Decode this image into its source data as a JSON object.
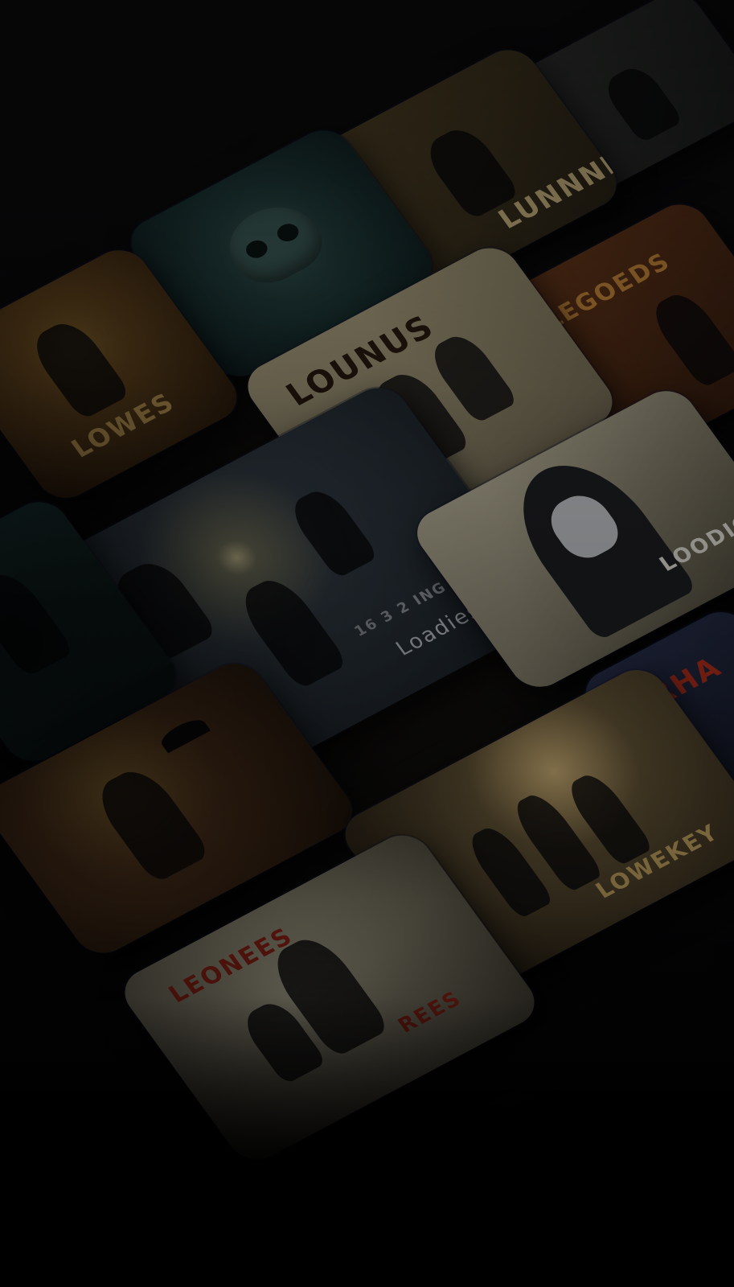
{
  "background": {
    "description_free": true,
    "colors": {
      "base": "#050506",
      "warm_glow": "#6b5530",
      "cool_edge": "#1c2552"
    }
  },
  "posters": [
    {
      "name": "poster-top-right",
      "title": "",
      "palette": [
        "#3a3d3a",
        "#1b1d1c"
      ],
      "title_color": "#c9b27a"
    },
    {
      "name": "poster-top-center",
      "title": "LUNNNN",
      "palette": [
        "#5a4a2a",
        "#2a2418"
      ],
      "title_color": "#d9c28a"
    },
    {
      "name": "poster-skull-teal",
      "title": "",
      "palette": [
        "#23403f",
        "#0f1f21"
      ],
      "title_color": "#b7c7b8"
    },
    {
      "name": "poster-orange-right",
      "title": "LEGOEDS",
      "palette": [
        "#6a3a1c",
        "#2a160c"
      ],
      "title_color": "#c98a3a"
    },
    {
      "name": "poster-orange-left",
      "title": "LOWES",
      "palette": [
        "#6a4a20",
        "#2a1a0c"
      ],
      "title_color": "#caa35a"
    },
    {
      "name": "poster-action-cream",
      "title": "LOUNUS",
      "palette": [
        "#b8ad8a",
        "#6e6650"
      ],
      "title_color": "#2a1a10"
    },
    {
      "name": "poster-hero-center",
      "title": "Loadies",
      "subtitle": "16 3 2 ING",
      "palette": [
        "#3a4650",
        "#141a20"
      ],
      "title_color": "#d8dde2"
    },
    {
      "name": "poster-hooded-mask",
      "title": "LOODIGE",
      "palette": [
        "#c9c2a8",
        "#4a4638"
      ],
      "title_color": "#e8e6dc"
    },
    {
      "name": "poster-teal-left",
      "title": "",
      "palette": [
        "#1e3a3a",
        "#0b1616"
      ],
      "title_color": "#9fb7a8"
    },
    {
      "name": "poster-red-right",
      "title": "RHA",
      "palette": [
        "#2a3250",
        "#10141f"
      ],
      "title_color": "#b8301e"
    },
    {
      "name": "poster-crowd",
      "title": "LOWEKEY",
      "palette": [
        "#6a5a3a",
        "#221a10"
      ],
      "title_color": "#d6b36a"
    },
    {
      "name": "poster-bird-orange",
      "title": "",
      "palette": [
        "#5a3a20",
        "#1e130a"
      ],
      "title_color": "#c98a3a"
    },
    {
      "name": "poster-leones",
      "title": "LEONEES",
      "subtitle": "REES",
      "palette": [
        "#a6a088",
        "#4e4a3c"
      ],
      "title_color": "#b02a1a"
    }
  ]
}
